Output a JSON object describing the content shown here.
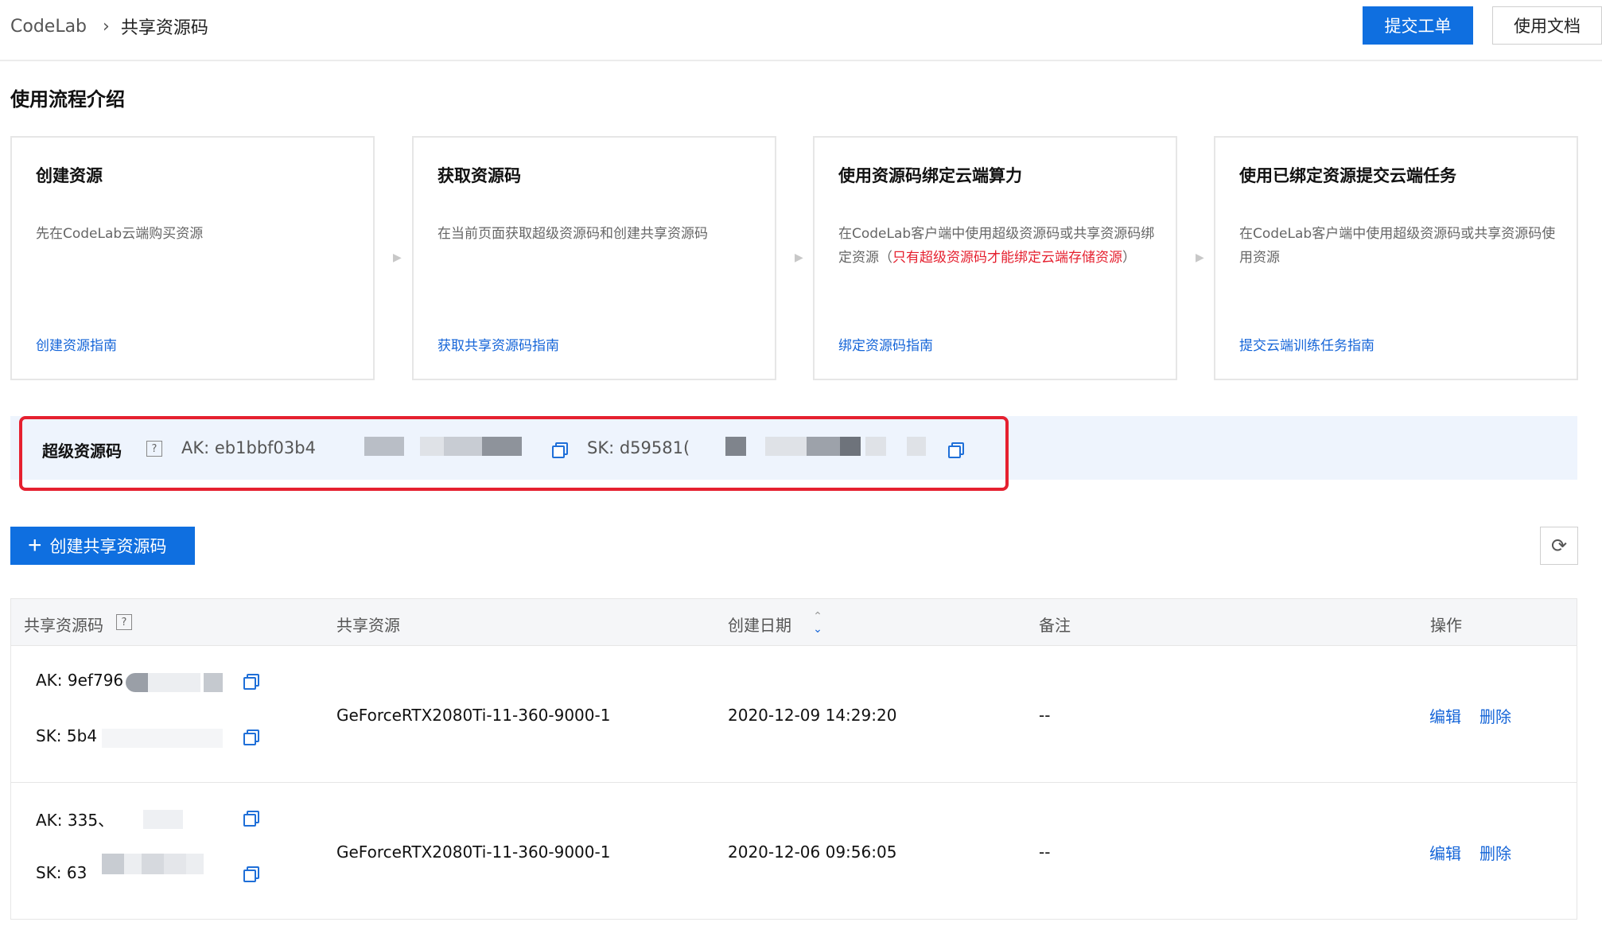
{
  "header": {
    "breadcrumb_root": "CodeLab",
    "breadcrumb_current": "共享资源码",
    "submit_ticket": "提交工单",
    "docs": "使用文档"
  },
  "section_title": "使用流程介绍",
  "steps": [
    {
      "title": "创建资源",
      "desc": "先在CodeLab云端购买资源",
      "link": "创建资源指南"
    },
    {
      "title": "获取资源码",
      "desc": "在当前页面获取超级资源码和创建共享资源码",
      "link": "获取共享资源码指南"
    },
    {
      "title": "使用资源码绑定云端算力",
      "desc": "在CodeLab客户端中使用超级资源码或共享资源码绑定资源（",
      "desc_warn": "只有超级资源码才能绑定云端存储资源",
      "desc_end": "）",
      "link": "绑定资源码指南"
    },
    {
      "title": "使用已绑定资源提交云端任务",
      "desc": "在CodeLab客户端中使用超级资源码或共享资源码使用资源",
      "link": "提交云端训练任务指南"
    }
  ],
  "super_key": {
    "label": "超级资源码",
    "ak": "AK: eb1bbf03b4",
    "sk": "SK: d59581("
  },
  "create_button": "创建共享资源码",
  "table": {
    "headers": {
      "code": "共享资源码",
      "resource": "共享资源",
      "date": "创建日期",
      "note": "备注",
      "ops": "操作"
    },
    "rows": [
      {
        "ak": "AK: 9ef796",
        "sk": "SK: 5b4",
        "resource": "GeForceRTX2080Ti-11-360-9000-1",
        "date": "2020-12-09 14:29:20",
        "note": "--",
        "edit": "编辑",
        "delete": "删除"
      },
      {
        "ak": "AK: 335、",
        "sk": "SK: 63",
        "resource": "GeForceRTX2080Ti-11-360-9000-1",
        "date": "2020-12-06 09:56:05",
        "note": "--",
        "edit": "编辑",
        "delete": "删除"
      }
    ]
  },
  "colors": {
    "primary": "#0f6fe0",
    "link": "#1565d8",
    "warn": "#e5202f",
    "highlight_bg": "#eef4fd"
  },
  "icons": {
    "breadcrumb_sep": "chevron-right-icon",
    "help": "help-icon",
    "copy": "copy-icon",
    "plus": "plus-icon",
    "refresh": "refresh-icon",
    "sort": "sort-icon",
    "step_arrow": "arrow-right-icon"
  }
}
